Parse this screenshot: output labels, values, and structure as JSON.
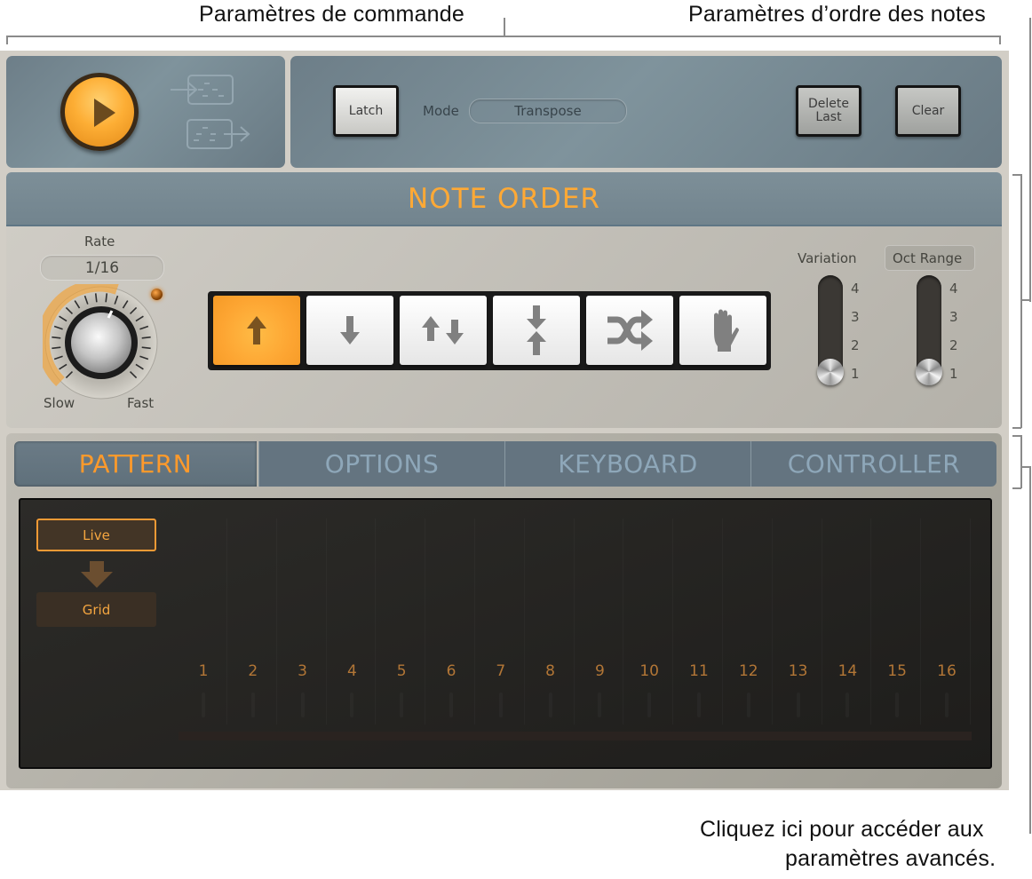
{
  "callouts": {
    "control_params": "Paramètres de commande",
    "note_order_params": "Paramètres d’ordre des notes",
    "advanced_params_line1": "Cliquez ici pour accéder aux",
    "advanced_params_line2": "paramètres avancés."
  },
  "transport": {
    "play_icon": "play-icon",
    "capture_in_icon": "capture-live-in-icon",
    "capture_out_icon": "capture-export-icon"
  },
  "control": {
    "latch_label": "Latch",
    "mode_label": "Mode",
    "mode_value": "Transpose",
    "delete_last_line1": "Delete",
    "delete_last_line2": "Last",
    "clear_label": "Clear"
  },
  "note_order": {
    "title": "NOTE ORDER",
    "rate_label": "Rate",
    "rate_value": "1/16",
    "rate_slow": "Slow",
    "rate_fast": "Fast",
    "buttons": [
      {
        "name": "up",
        "icon": "arrow-up-icon",
        "active": true
      },
      {
        "name": "down",
        "icon": "arrow-down-icon",
        "active": false
      },
      {
        "name": "up-down",
        "icon": "arrow-up-down-icon",
        "active": false
      },
      {
        "name": "outside-in",
        "icon": "arrows-converge-icon",
        "active": false
      },
      {
        "name": "random",
        "icon": "shuffle-icon",
        "active": false
      },
      {
        "name": "as-played",
        "icon": "hand-icon",
        "active": false
      }
    ],
    "variation_label": "Variation",
    "variation_value": 1,
    "oct_range_label": "Oct Range",
    "oct_range_value": 1,
    "slider_ticks": [
      "4",
      "3",
      "2",
      "1"
    ]
  },
  "tabs": [
    {
      "label": "PATTERN",
      "active": true
    },
    {
      "label": "OPTIONS",
      "active": false
    },
    {
      "label": "KEYBOARD",
      "active": false
    },
    {
      "label": "CONTROLLER",
      "active": false
    }
  ],
  "pattern": {
    "live_label": "Live",
    "grid_label": "Grid",
    "steps": [
      "1",
      "2",
      "3",
      "4",
      "5",
      "6",
      "7",
      "8",
      "9",
      "10",
      "11",
      "12",
      "13",
      "14",
      "15",
      "16"
    ]
  },
  "colors": {
    "accent_orange": "#ffa935",
    "tab_inactive_text": "#8ea7b9",
    "step_number": "#b27636"
  }
}
